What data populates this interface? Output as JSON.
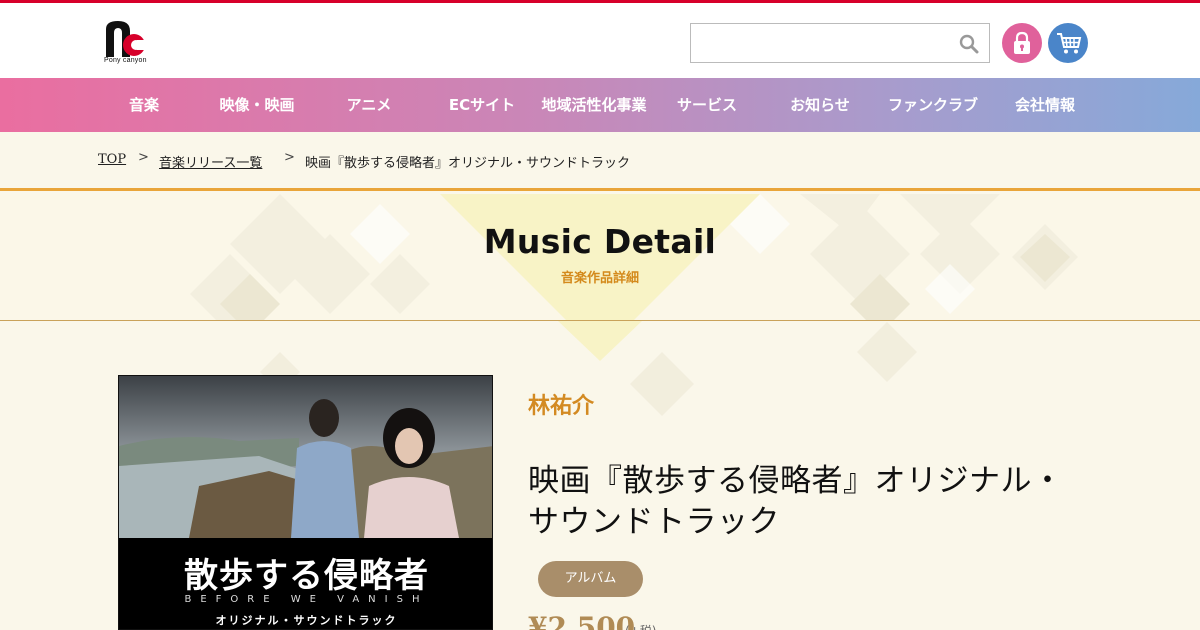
{
  "header": {
    "logo_text": "Pony canyon",
    "search": {
      "value": "",
      "placeholder": ""
    },
    "icons": {
      "search": "search-icon",
      "lock": "lock-icon",
      "cart": "cart-icon"
    },
    "colors": {
      "top_line": "#d7002a",
      "lock_button": "#e0619b",
      "cart_button": "#4a85c9"
    }
  },
  "nav": {
    "items": [
      {
        "label": "音楽"
      },
      {
        "label": "映像・映画"
      },
      {
        "label": "アニメ"
      },
      {
        "label": "ECサイト"
      },
      {
        "label": "地域活性化事業"
      },
      {
        "label": "サービス"
      },
      {
        "label": "お知らせ"
      },
      {
        "label": "ファンクラブ"
      },
      {
        "label": "会社情報"
      }
    ],
    "gradient": [
      "#ea6ea0",
      "#86a9d9"
    ]
  },
  "breadcrumb": {
    "items": [
      {
        "label": "TOP"
      },
      {
        "label": "音楽リリース一覧"
      },
      {
        "label": "映画『散歩する侵略者』オリジナル・サウンドトラック"
      }
    ],
    "separator": ">"
  },
  "hero": {
    "title": "Music Detail",
    "subtitle": "音楽作品詳細"
  },
  "product": {
    "cover": {
      "title": "散歩する侵略者",
      "english": "BEFORE WE VANISH",
      "subtitle": "オリジナル・サウンドトラック"
    },
    "artist": "林祐介",
    "title_line1": "映画『散歩する侵略者』オリジナル・",
    "title_line2": "サウンドトラック",
    "type": "アルバム",
    "price": "¥2,500",
    "price_note": "(+税)",
    "colors": {
      "artist": "#d38a22",
      "badge": "#a98e6a",
      "price": "#b08b55"
    }
  }
}
